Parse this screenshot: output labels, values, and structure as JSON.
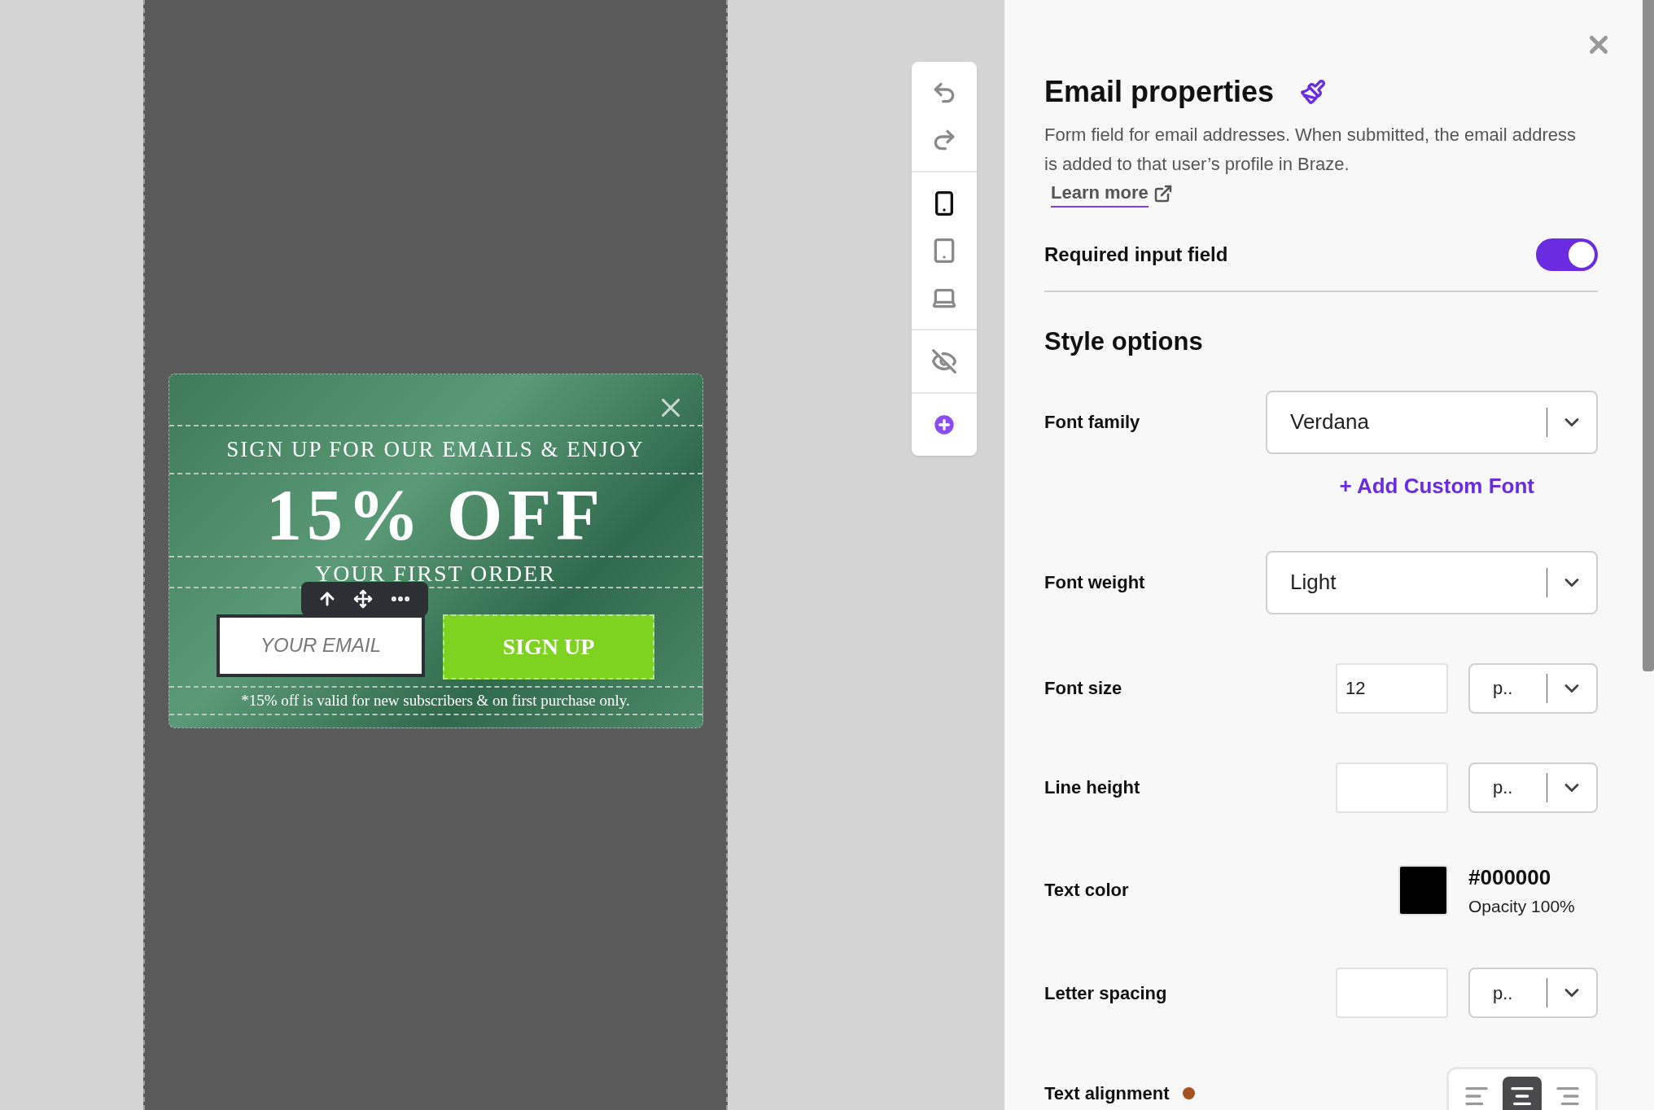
{
  "canvas": {
    "popup": {
      "heading": "SIGN UP FOR OUR EMAILS & ENJOY",
      "headline": "15% OFF",
      "subheading": "YOUR FIRST ORDER",
      "email_field": {
        "placeholder": "YOUR EMAIL"
      },
      "submit_button": "SIGN UP",
      "disclaimer": "*15% off is valid for new subscribers & on first purchase only."
    }
  },
  "toolbar": {
    "devices": [
      {
        "kind": "phone",
        "selected": true
      },
      {
        "kind": "tablet",
        "selected": false
      },
      {
        "kind": "laptop",
        "selected": false
      }
    ]
  },
  "panel": {
    "title": "Email properties",
    "description": "Form field for email addresses. When submitted, the email address is added to that user’s profile in Braze.",
    "learn_more": "Learn more",
    "required": {
      "label": "Required input field",
      "on": true
    },
    "section_title": "Style options",
    "rows": [
      {
        "kind": "select",
        "label": "Font family",
        "value": "Verdana",
        "action": "+ Add Custom Font"
      },
      {
        "kind": "select",
        "label": "Font weight",
        "value": "Light"
      },
      {
        "kind": "size",
        "label": "Font size",
        "value": "12",
        "unit": "p.."
      },
      {
        "kind": "size",
        "label": "Line height",
        "unit": "p.."
      },
      {
        "kind": "color",
        "label": "Text color",
        "hex": "#000000",
        "opacity": "Opacity 100%"
      },
      {
        "kind": "size",
        "label": "Letter spacing",
        "unit": "p.."
      },
      {
        "kind": "alignment",
        "label": "Text alignment",
        "color": "#a5521f",
        "options": [
          {
            "kind": "left",
            "selected": false
          },
          {
            "kind": "center",
            "selected": true
          },
          {
            "kind": "right",
            "selected": false
          }
        ]
      }
    ]
  }
}
